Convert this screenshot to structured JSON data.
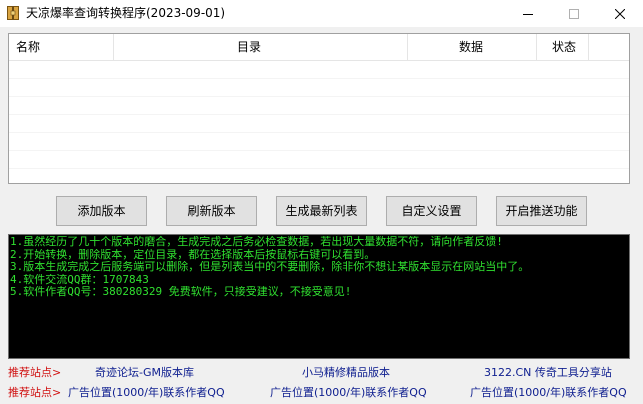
{
  "window": {
    "title": "天凉爆率查询转换程序(2023-09-01)"
  },
  "table": {
    "columns": [
      "名称",
      "目录",
      "数据",
      "状态"
    ],
    "rows": []
  },
  "buttons": {
    "add_version": "添加版本",
    "refresh_version": "刷新版本",
    "generate_list": "生成最新列表",
    "custom_settings": "自定义设置",
    "enable_push": "开启推送功能"
  },
  "console": {
    "lines": [
      "1.虽然经历了几十个版本的磨合，生成完成之后务必检查数据，若出现大量数据不符，请向作者反馈!",
      "2.开始转换，删除版本，定位目录，都在选择版本后按鼠标右键可以看到。",
      "3.版本生成完成之后服务端可以删除，但是列表当中的不要删除，除非你不想让某版本显示在网站当中了。",
      "4.软件交流QQ群：1707843",
      "5.软件作者QQ号：380280329 免费软件，只接受建议，不接受意见!"
    ],
    "text_color": "#30e030",
    "background": "#000000"
  },
  "footer": {
    "row1": {
      "label": "推荐站点>",
      "links": [
        "奇迹论坛-GM版本库",
        "小马精修精品版本",
        "3122.CN 传奇工具分享站"
      ]
    },
    "row2": {
      "label": "推荐站点>",
      "links": [
        "广告位置(1000/年)联系作者QQ",
        "广告位置(1000/年)联系作者QQ",
        "广告位置(1000/年)联系作者QQ"
      ]
    },
    "label_color": "#d01010",
    "link_color": "#102090"
  },
  "icons": {
    "app": "archive-book-icon",
    "minimize": "minimize-icon",
    "maximize": "maximize-icon",
    "close": "close-icon"
  }
}
